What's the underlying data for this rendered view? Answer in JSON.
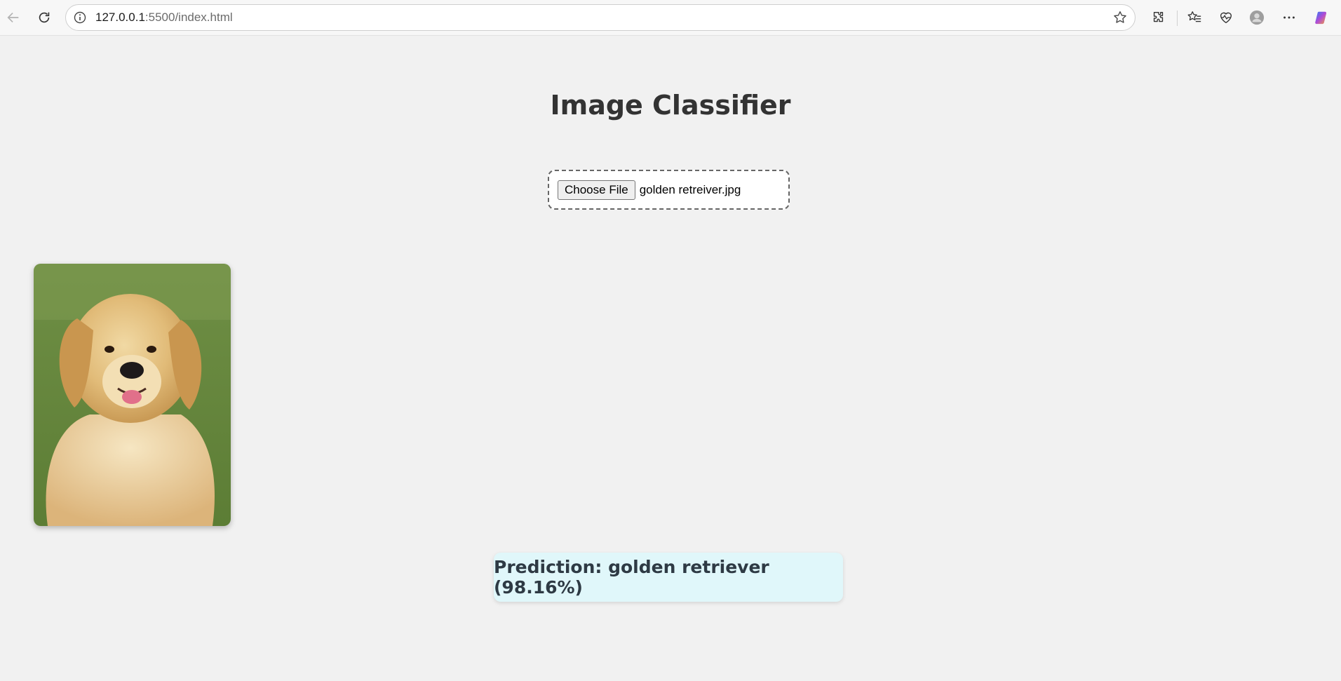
{
  "browser": {
    "url_host": "127.0.0.1",
    "url_rest": ":5500/index.html"
  },
  "page": {
    "title": "Image Classifier",
    "upload": {
      "button_label": "Choose File",
      "file_name": "golden retreiver.jpg"
    },
    "result": {
      "text": "Prediction: golden retriever (98.16%)"
    }
  },
  "colors": {
    "background": "#f1f1f1",
    "result_bg": "#e0f7fa",
    "title": "#333333"
  }
}
